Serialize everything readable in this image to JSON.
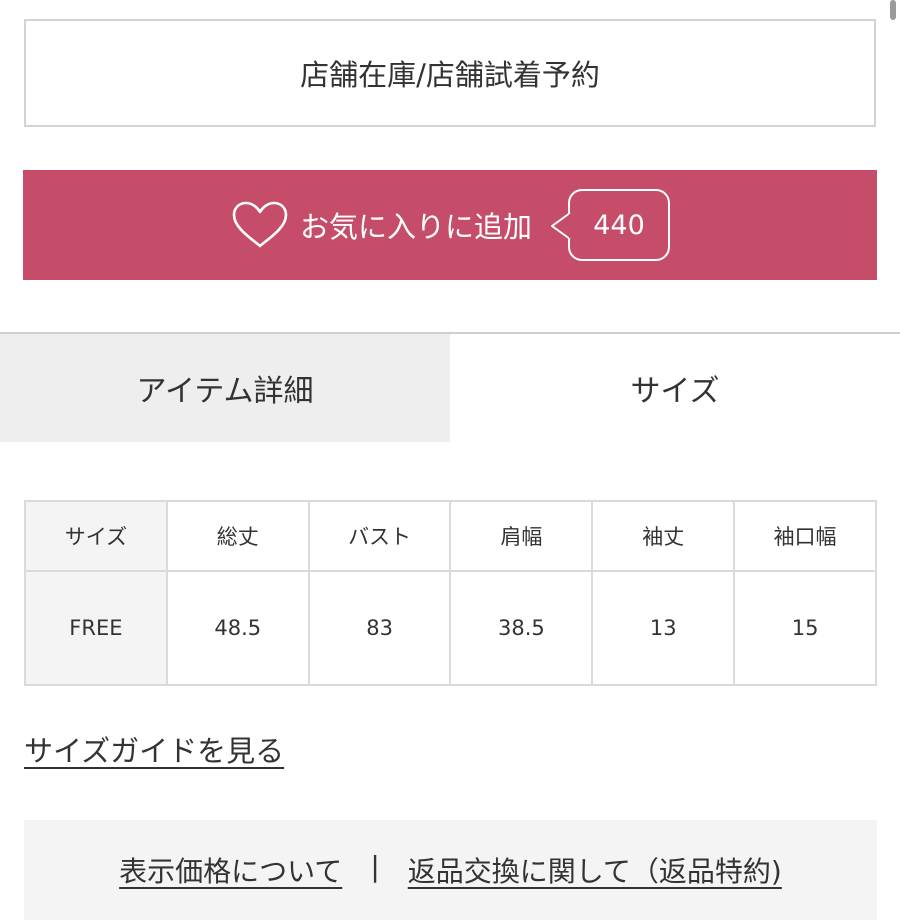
{
  "store_button": {
    "label": "店舗在庫/店舗試着予約"
  },
  "favorite_button": {
    "label": "お気に入りに追加",
    "count": "440",
    "icon": "heart-icon",
    "color": "#c64d69"
  },
  "tabs": [
    {
      "label": "アイテム詳細",
      "selected": false
    },
    {
      "label": "サイズ",
      "selected": true
    }
  ],
  "size_table": {
    "headers": [
      "サイズ",
      "総丈",
      "バスト",
      "肩幅",
      "袖丈",
      "袖口幅"
    ],
    "rows": [
      [
        "FREE",
        "48.5",
        "83",
        "38.5",
        "13",
        "15"
      ]
    ]
  },
  "size_guide_link": "サイズガイドを見る",
  "footer_links": {
    "price": "表示価格について",
    "separator": "|",
    "returns": "返品交換に関して（返品特約)"
  }
}
